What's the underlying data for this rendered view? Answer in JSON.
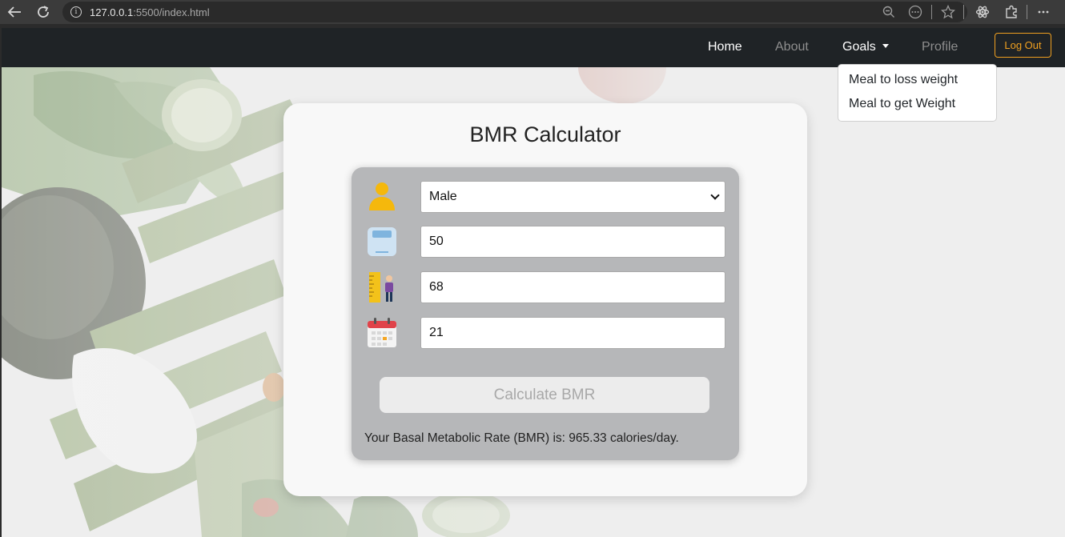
{
  "browser": {
    "url_host": "127.0.0.1",
    "url_rest": ":5500/index.html"
  },
  "navbar": {
    "items": [
      {
        "label": "Home"
      },
      {
        "label": "About"
      },
      {
        "label": "Goals"
      },
      {
        "label": "Profile"
      }
    ],
    "logout_label": "Log Out"
  },
  "goals_dropdown": {
    "items": [
      {
        "label": "Meal to loss weight"
      },
      {
        "label": "Meal to get Weight"
      }
    ]
  },
  "calculator": {
    "title": "BMR Calculator",
    "gender": "Male",
    "weight": "50",
    "height": "68",
    "age": "21",
    "button_label": "Calculate BMR",
    "result_text": "Your Basal Metabolic Rate (BMR) is: 965.33 calories/day."
  },
  "colors": {
    "navbar_bg": "#1f2326",
    "logout_accent": "#f0a020",
    "card_bg": "#f8f8f8",
    "panel_bg": "#b6b7b9"
  }
}
